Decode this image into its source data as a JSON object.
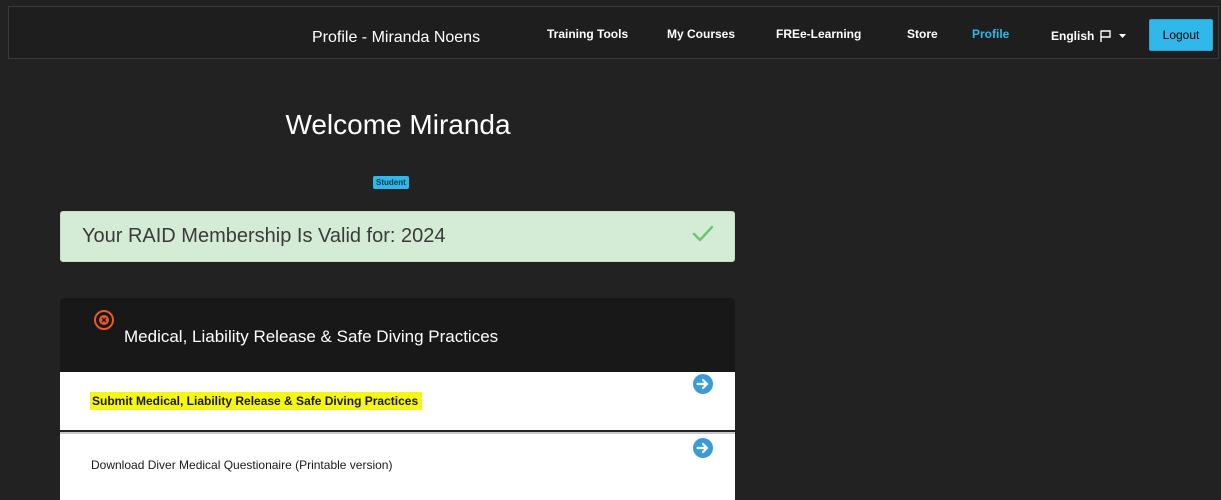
{
  "navbar": {
    "brand": "Profile - Miranda Noens",
    "items": [
      {
        "label": "Training Tools"
      },
      {
        "label": "My Courses"
      },
      {
        "label": "FREe-Learning"
      },
      {
        "label": "Store"
      },
      {
        "label": "Profile",
        "active": true
      }
    ],
    "language": "English",
    "logout": "Logout"
  },
  "welcome": {
    "title": "Welcome Miranda",
    "role_badge": "Student"
  },
  "membership": {
    "text": "Your RAID Membership Is Valid for: 2024",
    "status_icon": "check-icon"
  },
  "medical_panel": {
    "title": "Medical, Liability Release & Safe Diving Practices",
    "status_icon": "error-circle-icon",
    "rows": [
      {
        "label": "Submit Medical, Liability Release & Safe Diving Practices",
        "highlighted": true,
        "icon": "arrow-circle-right-icon"
      },
      {
        "label": "Download Diver Medical Questionaire (Printable version)",
        "highlighted": false,
        "icon": "arrow-circle-right-icon"
      }
    ]
  },
  "colors": {
    "background": "#222222",
    "accent": "#2fb8e9",
    "success_bg": "#d4ecd6",
    "success_icon": "#6cc86c",
    "error_icon": "#e8572f",
    "highlight": "#f5f516"
  }
}
